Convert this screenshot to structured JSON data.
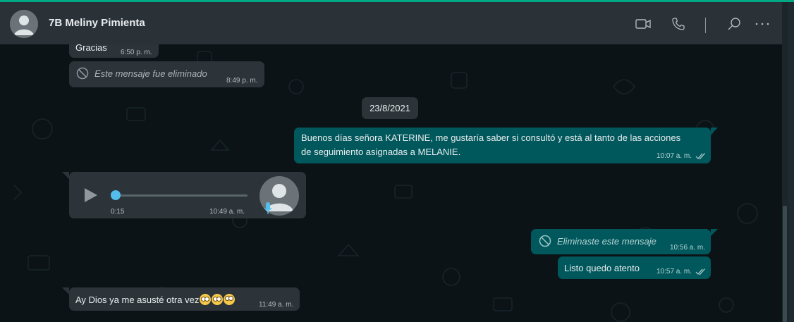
{
  "header": {
    "contact_name": "7B Meliny Pimienta",
    "icons": [
      "video-call-icon",
      "voice-call-icon",
      "search-icon",
      "menu-icon"
    ]
  },
  "messages": {
    "m1": {
      "text": "Gracias",
      "time": "6:50 p. m."
    },
    "m2": {
      "text": "Este mensaje fue eliminado",
      "time": "8:49 p. m."
    },
    "date_divider": "23/8/2021",
    "m3": {
      "line1": "Buenos días señora KATERINE, me gustaría saber si consultó y está al tanto de las acciones",
      "line2": "de seguimiento asignadas a MELANIE.",
      "time": "10:07 a. m."
    },
    "voice": {
      "duration": "0:15",
      "time": "10:49 a. m."
    },
    "m5": {
      "text": "Eliminaste este mensaje",
      "time": "10:56 a. m."
    },
    "m6": {
      "text": "Listo quedo atento",
      "time": "10:57 a. m."
    },
    "m7": {
      "text": "Ay Dios ya me asusté otra vez",
      "time": "11:49 a. m."
    }
  },
  "colors": {
    "accent": "#00a884",
    "outgoing_bubble": "#00585c",
    "incoming_bubble": "#2c3439",
    "header": "#2a3137",
    "chat_background": "#0b1317"
  }
}
